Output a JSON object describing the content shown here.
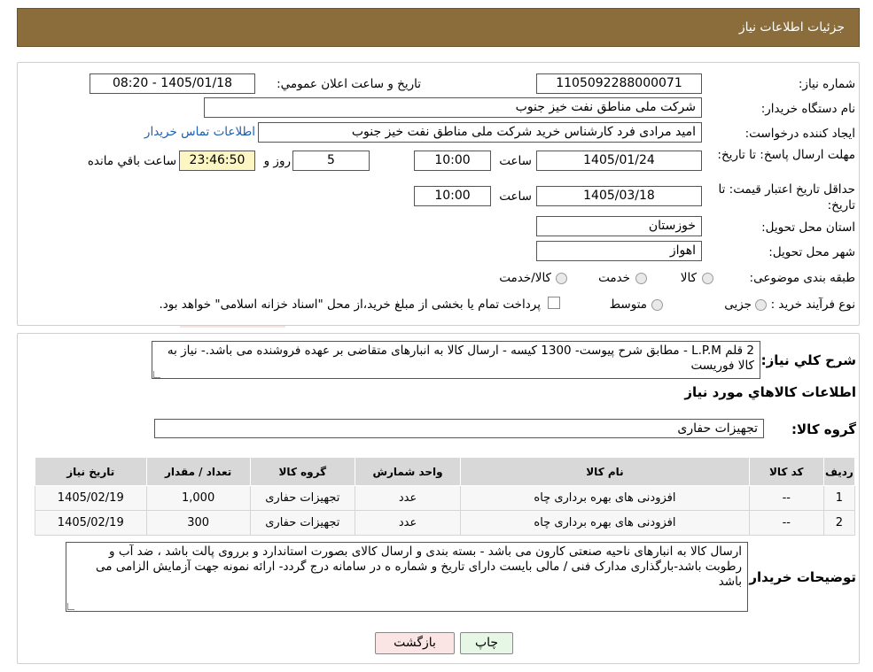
{
  "header": {
    "title": "جزئیات اطلاعات نیاز"
  },
  "fields": {
    "need_number_label": "شماره نیاز:",
    "need_number": "1105092288000071",
    "announce_label": "تاریخ و ساعت اعلان عمومي:",
    "announce_value": "1405/01/18 - 08:20",
    "buyer_org_label": "نام دستگاه خریدار:",
    "buyer_org": "شرکت ملی مناطق نفت خیز جنوب",
    "creator_label": "ایجاد کننده درخواست:",
    "creator": "امید مرادی فرد کارشناس خرید شرکت ملی مناطق نفت خیز جنوب",
    "contact_link": "اطلاعات تماس خریدار",
    "deadline_label": "مهلت ارسال پاسخ: تا تاریخ:",
    "deadline_date": "1405/01/24",
    "time_label": "ساعت",
    "deadline_time": "10:00",
    "days_value": "5",
    "days_label": "روز و",
    "remaining_time": "23:46:50",
    "remaining_label": "ساعت باقي مانده",
    "validity_label": "حداقل تاریخ اعتبار قیمت: تا تاریخ:",
    "validity_date": "1405/03/18",
    "validity_time": "10:00",
    "province_label": "استان محل تحویل:",
    "province": "خوزستان",
    "city_label": "شهر محل تحویل:",
    "city": "اهواز",
    "category_label": "طبقه بندی موضوعی:",
    "category_options": [
      "کالا",
      "خدمت",
      "کالا/خدمت"
    ],
    "process_label": "نوع فرآیند خرید :",
    "process_options": [
      "جزیی",
      "متوسط"
    ],
    "process_note": "پرداخت تمام یا بخشی از مبلغ خرید،از محل \"اسناد خزانه اسلامی\" خواهد بود."
  },
  "description": {
    "label": "شرح کلي نياز:",
    "text": "2 قلم L.P.M - مطابق شرح پیوست- 1300 کیسه - ارسال کالا به انبارهای متقاضی بر عهده فروشنده می باشد.- نیاز به کالا فوریست"
  },
  "goods_section": {
    "title": "اطلاعات کالاهاي مورد نياز",
    "group_label": "گروه کالا:",
    "group_value": "تجهیزات حفاری"
  },
  "table": {
    "headers": [
      "رديف",
      "کد کالا",
      "نام کالا",
      "واحد شمارش",
      "گروه کالا",
      "تعداد / مقدار",
      "تاریخ نیاز"
    ],
    "rows": [
      [
        "1",
        "--",
        "افزودنی های بهره برداری چاه",
        "عدد",
        "تجهیزات حفاری",
        "1,000",
        "1405/02/19"
      ],
      [
        "2",
        "--",
        "افزودنی های بهره برداری چاه",
        "عدد",
        "تجهیزات حفاری",
        "300",
        "1405/02/19"
      ]
    ]
  },
  "buyer_notes": {
    "label": "توضیحات خریدار:",
    "text": "ارسال کالا به انبارهای ناحیه صنعتی کارون می باشد - بسته بندی و ارسال کالای بصورت استاندارد و برروی پالت باشد ، ضد آب و رطوبت باشد-بارگذاری مدارک فنی / مالی بایست دارای تاریخ و شماره ه در سامانه درج گردد- ارائه نمونه جهت آزمایش الزامی می باشد"
  },
  "buttons": {
    "print": "چاپ",
    "back": "بازگشت"
  },
  "colors": {
    "header_bg": "#8a6d3b",
    "remaining_bg": "#fdf6c2",
    "link": "#1a5fb4"
  }
}
